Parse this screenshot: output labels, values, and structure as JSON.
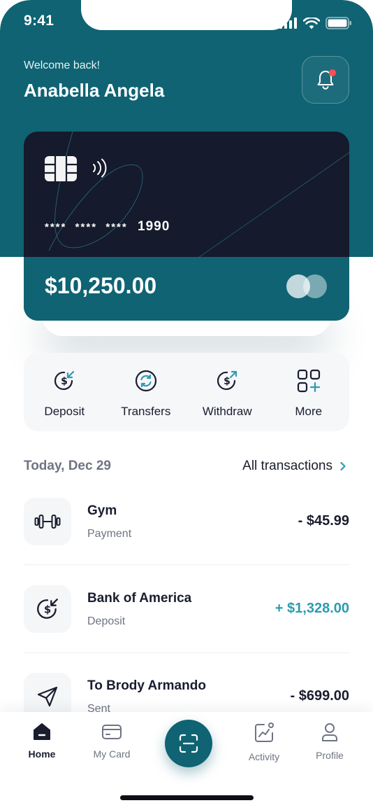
{
  "status": {
    "time": "9:41"
  },
  "header": {
    "welcome": "Welcome back!",
    "name": "Anabella Angela"
  },
  "card": {
    "number_masked": "****  ****  ****",
    "number_last4": "1990",
    "balance": "$10,250.00"
  },
  "actions": [
    {
      "label": "Deposit",
      "icon": "deposit-icon"
    },
    {
      "label": "Transfers",
      "icon": "transfer-icon"
    },
    {
      "label": "Withdraw",
      "icon": "withdraw-icon"
    },
    {
      "label": "More",
      "icon": "more-grid-icon"
    }
  ],
  "transactions_header": {
    "date": "Today, Dec 29",
    "all_link": "All transactions"
  },
  "transactions": [
    {
      "title": "Gym",
      "subtitle": "Payment",
      "amount": "- $45.99",
      "icon": "dumbbell-icon",
      "positive": false
    },
    {
      "title": "Bank of America",
      "subtitle": "Deposit",
      "amount": "+ $1,328.00",
      "icon": "deposit-icon",
      "positive": true
    },
    {
      "title": "To Brody Armando",
      "subtitle": "Sent",
      "amount": "- $699.00",
      "icon": "send-icon",
      "positive": false
    }
  ],
  "nav": [
    {
      "label": "Home",
      "icon": "home-icon",
      "active": true
    },
    {
      "label": "My Card",
      "icon": "card-icon",
      "active": false
    },
    {
      "label": "Activity",
      "icon": "activity-icon",
      "active": false
    },
    {
      "label": "Profile",
      "icon": "profile-icon",
      "active": false
    }
  ],
  "colors": {
    "primary": "#0f6373",
    "card_dark": "#151a2c",
    "positive": "#2e9bb1",
    "alert": "#ff4b55"
  }
}
